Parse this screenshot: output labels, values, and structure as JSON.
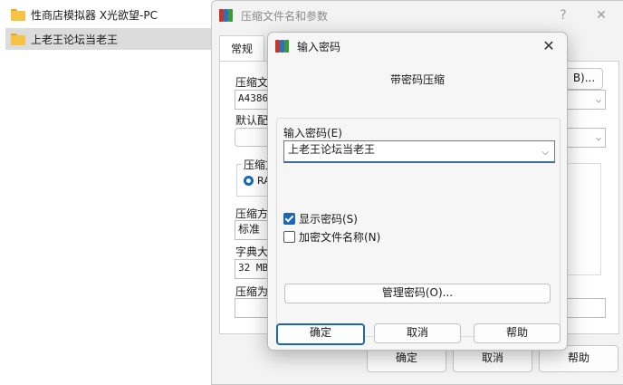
{
  "explorer": {
    "items": [
      {
        "label": "性商店模拟器 X光欲望-PC"
      },
      {
        "label": "上老王论坛当老王"
      }
    ]
  },
  "main_window": {
    "title": "压缩文件名和参数",
    "help_glyph": "?",
    "close_glyph": "✕",
    "tab_general": "常规",
    "filename_label": "压缩文",
    "filename_value": "A4386.",
    "browse_label": "B)...",
    "profile_label": "默认配",
    "format_group_label": "压缩文",
    "format_option": "RA",
    "method_label": "压缩方",
    "method_value": "标准",
    "dict_label": "字典大",
    "dict_value": "32 MB",
    "split_label": "压缩为",
    "ok": "确定",
    "cancel": "取消",
    "help": "帮助"
  },
  "password_dialog": {
    "title": "输入密码",
    "close_glyph": "✕",
    "heading": "带密码压缩",
    "password_label": "输入密码(E)",
    "password_value": "上老王论坛当老王",
    "show_password_label": "显示密码(S)",
    "show_password_checked": true,
    "encrypt_names_label": "加密文件名称(N)",
    "encrypt_names_checked": false,
    "manage_button": "管理密码(O)...",
    "ok": "确定",
    "cancel": "取消",
    "help": "帮助"
  },
  "colors": {
    "accent": "#1a66b8",
    "folder": "#f6c445"
  }
}
